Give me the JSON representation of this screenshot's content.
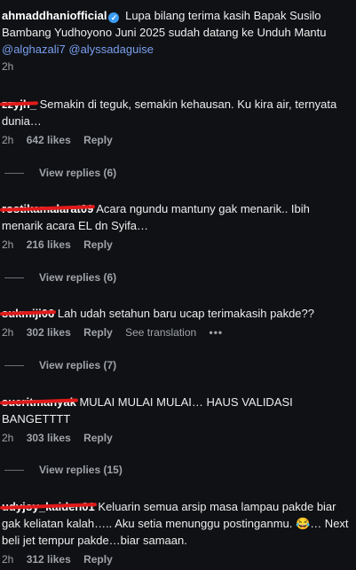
{
  "caption": {
    "username": "ahmaddhaniofficial",
    "verified_icon": "✓",
    "text": "Lupa bilang terima kasih Bapak Susilo Bambang Yudhoyono Juni 2025 sudah datang ke Unduh Mantu",
    "mention1": "@alghazali7",
    "mention2": "@alyssadaguise",
    "time": "2h"
  },
  "comments": [
    {
      "username": "zzyjh_",
      "text": "Semakin di teguk, semakin kehausan. Ku kira air, ternyata dunia…",
      "time": "2h",
      "likes": "642 likes",
      "reply": "Reply",
      "view_replies": "View replies (6)"
    },
    {
      "username": "rostikamalarat09",
      "text": "Acara ngundu mantuny gak menarik.. Ibih menarik acara EL dn Syifa…",
      "time": "2h",
      "likes": "216 likes",
      "reply": "Reply",
      "view_replies": "View replies (6)"
    },
    {
      "username": "sukmiji06",
      "text": "Lah udah setahun baru ucap terimakasih pakde??",
      "time": "2h",
      "likes": "302 likes",
      "reply": "Reply",
      "translate": "See translation",
      "more": "•••",
      "view_replies": "View replies (7)"
    },
    {
      "username": "sueritmanyak",
      "text": "MULAI MULAI MULAI… HAUS VALIDASI BANGETTTT",
      "time": "2h",
      "likes": "303 likes",
      "reply": "Reply",
      "view_replies": "View replies (15)"
    },
    {
      "username": "udyjoy_kaiden01",
      "text": "Keluarin semua arsip masa lampau pakde biar gak keliatan kalah….. Aku setia menunggu postinganmu.",
      "emoji": "😂",
      "text2": "… Next beli jet tempur pakde…biar samaan.",
      "time": "2h",
      "likes": "312 likes",
      "reply": "Reply"
    }
  ]
}
